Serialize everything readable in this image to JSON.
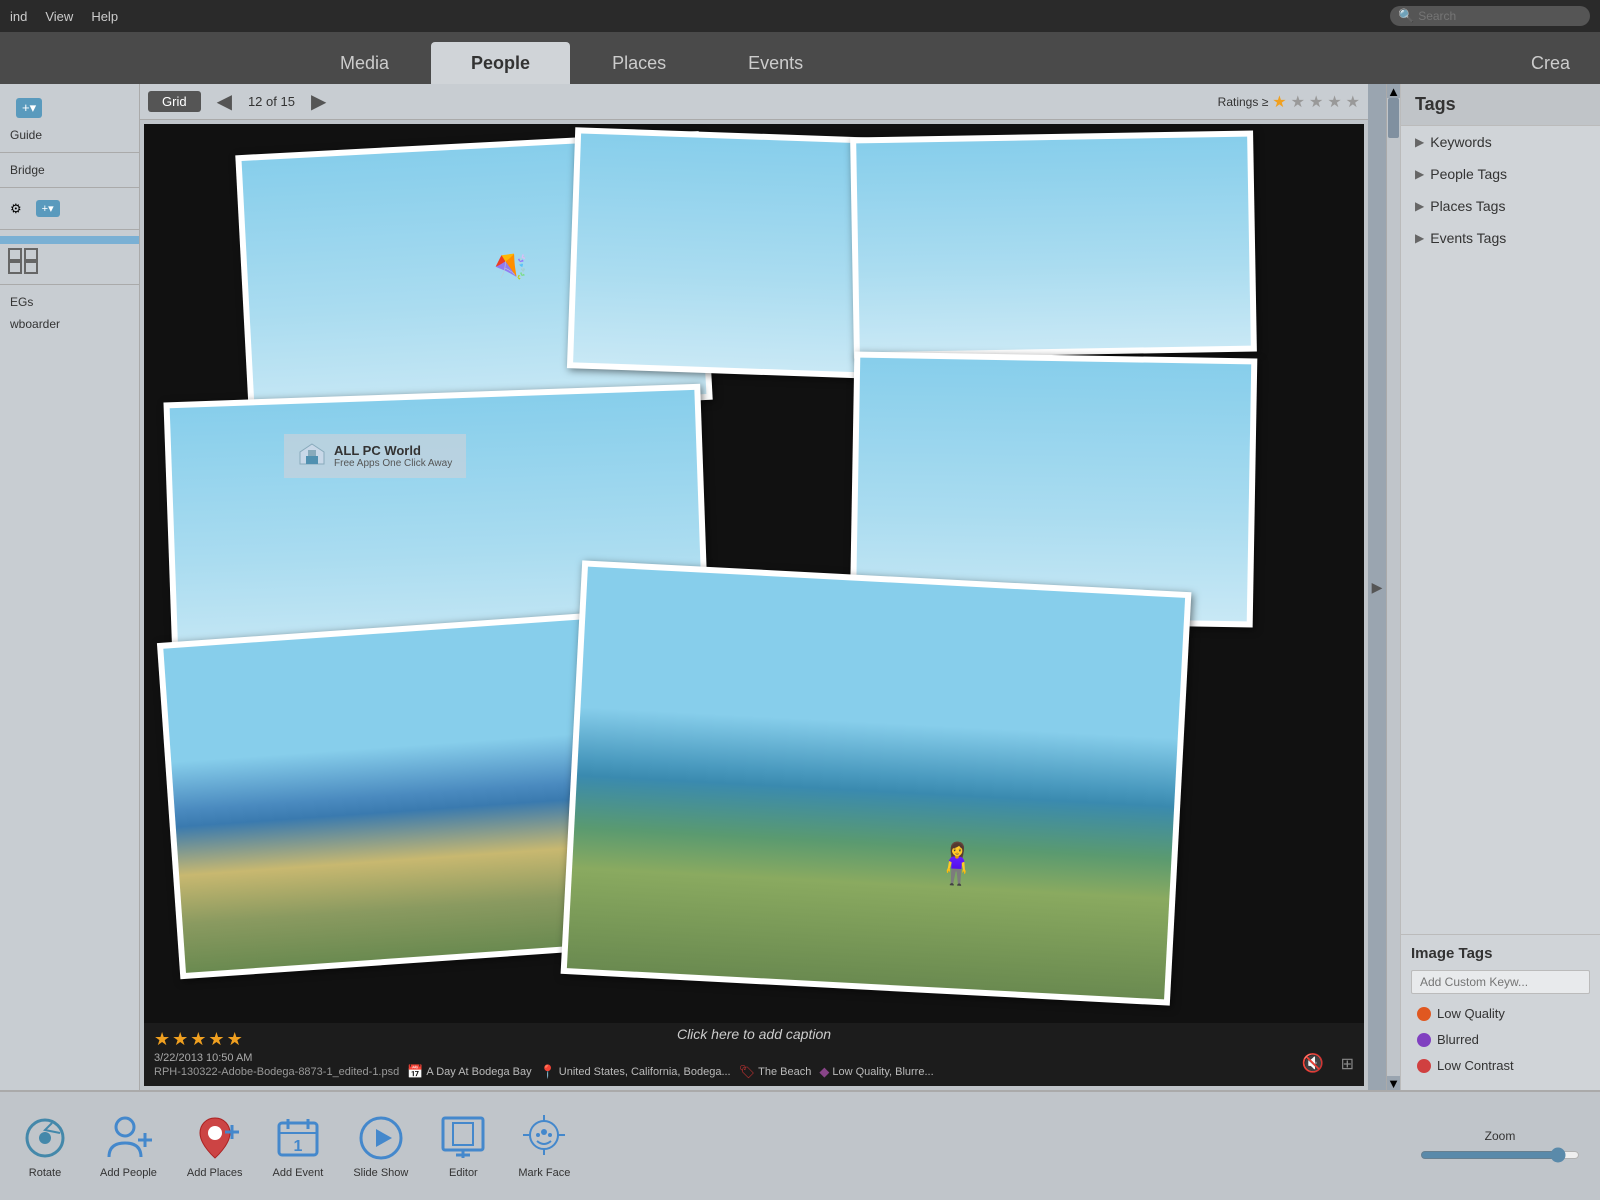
{
  "menu": {
    "items": [
      "ind",
      "View",
      "Help"
    ],
    "search_placeholder": "Search"
  },
  "nav_tabs": {
    "tabs": [
      {
        "label": "Media",
        "active": false
      },
      {
        "label": "People",
        "active": true
      },
      {
        "label": "Places",
        "active": false
      },
      {
        "label": "Events",
        "active": false
      }
    ],
    "create_label": "Crea"
  },
  "toolbar": {
    "grid_label": "Grid",
    "page_info": "12 of 15",
    "ratings_label": "Ratings ≥"
  },
  "photo": {
    "number": "12",
    "caption_placeholder": "Click here to add caption",
    "rating_count": 5,
    "meta_datetime": "3/22/2013 10:50 AM",
    "meta_path": "RPH-130322-Adobe-Bodega-8873-1_edited-1.psd",
    "meta_location": "A Day At Bodega Bay",
    "meta_country": "United States, California, Bodega...",
    "meta_tag1": "The Beach",
    "meta_tag2": "Low Quality, Blurre..."
  },
  "watermark": {
    "title": "ALL PC World",
    "subtitle": "Free Apps One Click Away"
  },
  "sidebar_left": {
    "guide_label": "Guide",
    "bridge_label": "Bridge",
    "item_label1": "EGs",
    "item_label2": "wboarder"
  },
  "sidebar_right": {
    "title": "Tags",
    "items": [
      {
        "label": "Keywords"
      },
      {
        "label": "People Tags"
      },
      {
        "label": "Places Tags"
      },
      {
        "label": "Events Tags"
      }
    ],
    "image_tags_title": "Image Tags",
    "add_keyword_placeholder": "Add Custom Keyw...",
    "tags": [
      {
        "label": "Low Quality",
        "color": "orange"
      },
      {
        "label": "Blurred",
        "color": "purple"
      },
      {
        "label": "Low Contrast",
        "color": "red"
      }
    ]
  },
  "bottom_toolbar": {
    "buttons": [
      {
        "label": "Rotate",
        "icon": "rotate"
      },
      {
        "label": "Add People",
        "icon": "add-people"
      },
      {
        "label": "Add Places",
        "icon": "add-places"
      },
      {
        "label": "Add Event",
        "icon": "add-event"
      },
      {
        "label": "Slide Show",
        "icon": "slideshow"
      },
      {
        "label": "Editor",
        "icon": "editor"
      },
      {
        "label": "Mark Face",
        "icon": "mark-face"
      }
    ],
    "zoom_label": "Zoom"
  }
}
